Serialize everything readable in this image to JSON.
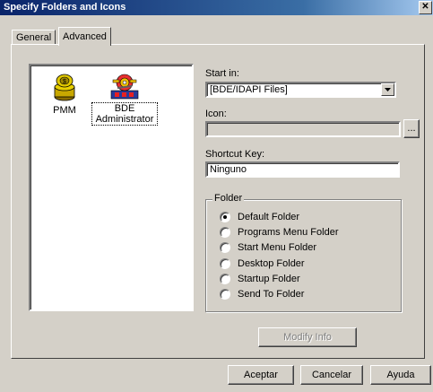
{
  "window": {
    "title": "Specify Folders and Icons",
    "close_glyph": "✕"
  },
  "tabs": [
    {
      "label": "General"
    },
    {
      "label": "Advanced"
    }
  ],
  "icon_list": {
    "items": [
      {
        "label": "PMM",
        "icon": "coin-stack-icon"
      },
      {
        "label": "BDE Administrator",
        "icon": "bde-gear-icon"
      }
    ]
  },
  "start_in": {
    "label": "Start in:",
    "value": "[BDE/IDAPI Files]"
  },
  "icon_field": {
    "label": "Icon:",
    "value": "",
    "browse_label": "..."
  },
  "shortcut_key": {
    "label": "Shortcut Key:",
    "value": "Ninguno"
  },
  "folder_group": {
    "title": "Folder",
    "options": [
      {
        "label": "Default Folder",
        "checked": true
      },
      {
        "label": "Programs Menu Folder",
        "checked": false
      },
      {
        "label": "Start Menu Folder",
        "checked": false
      },
      {
        "label": "Desktop Folder",
        "checked": false
      },
      {
        "label": "Startup Folder",
        "checked": false
      },
      {
        "label": "Send To Folder",
        "checked": false
      }
    ]
  },
  "modify_info_label": "Modify Info",
  "footer": {
    "ok_label": "Aceptar",
    "cancel_label": "Cancelar",
    "help_label": "Ayuda"
  }
}
